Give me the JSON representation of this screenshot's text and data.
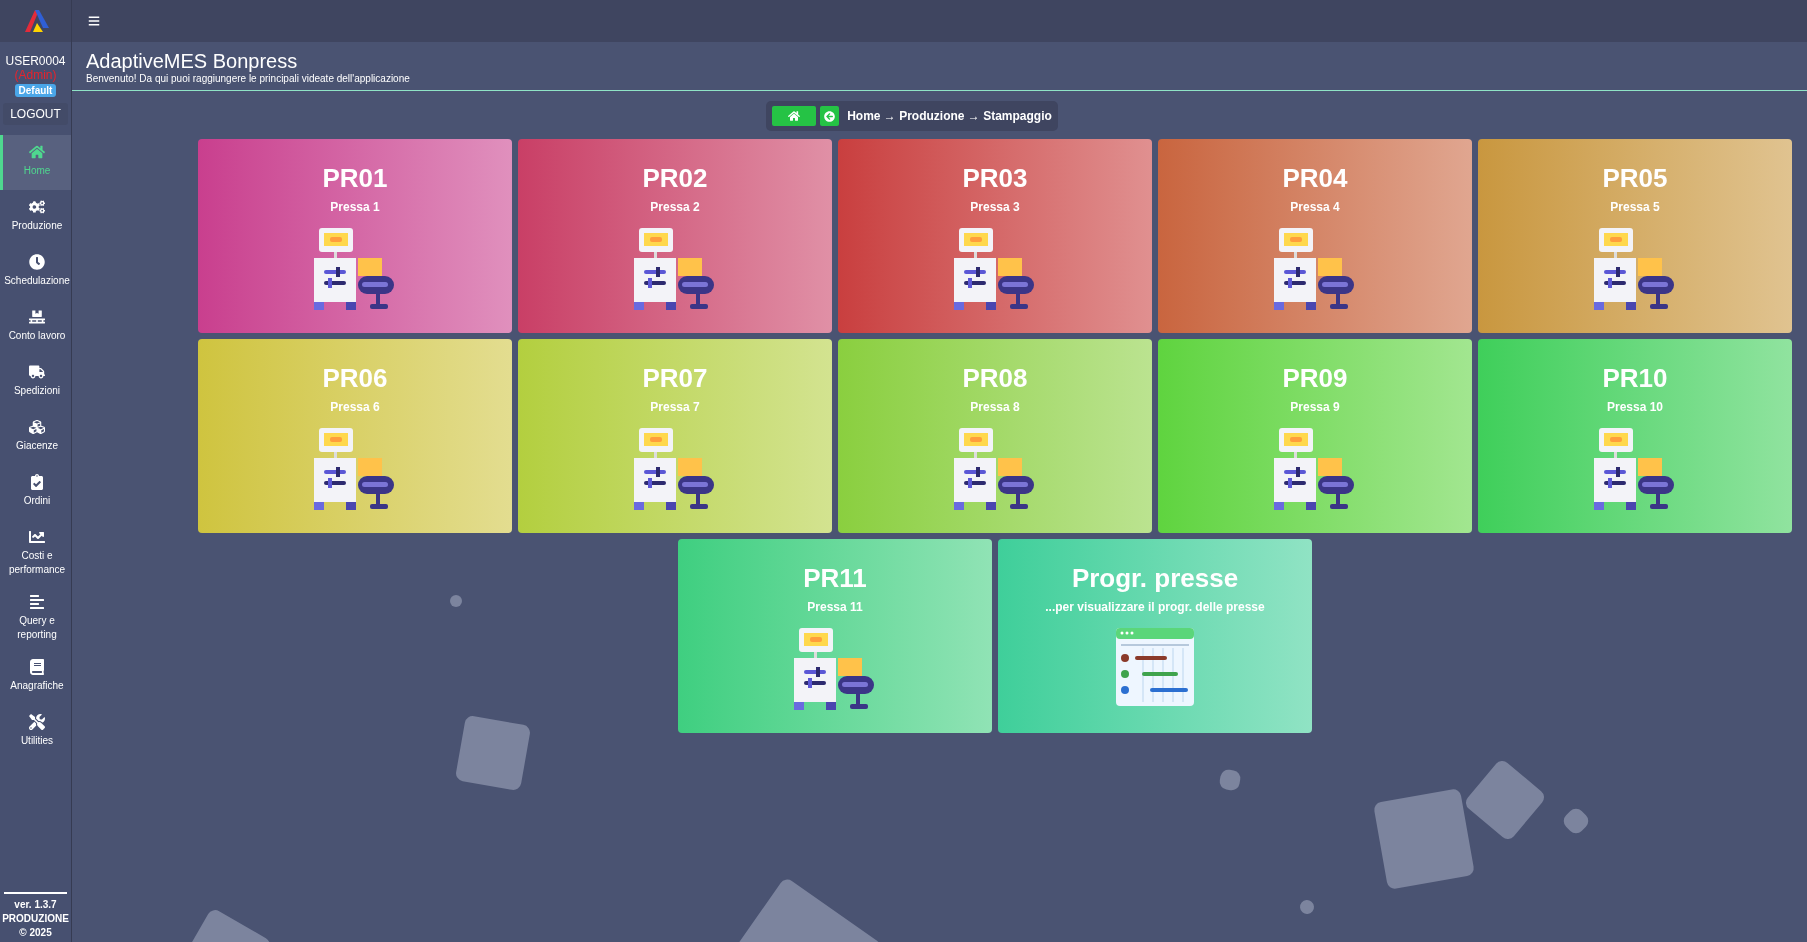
{
  "user": {
    "name": "USER0004",
    "role": "(Admin)",
    "profile": "Default",
    "logout": "LOGOUT"
  },
  "sidebar": {
    "items": [
      {
        "label": "Home",
        "selected": true
      },
      {
        "label": "Produzione",
        "selected": false
      },
      {
        "label": "Schedulazione",
        "selected": false
      },
      {
        "label": "Conto lavoro",
        "selected": false
      },
      {
        "label": "Spedizioni",
        "selected": false
      },
      {
        "label": "Giacenze",
        "selected": false
      },
      {
        "label": "Ordini",
        "selected": false
      },
      {
        "label": "Costi e performance",
        "selected": false
      },
      {
        "label": "Query e reporting",
        "selected": false
      },
      {
        "label": "Anagrafiche",
        "selected": false
      },
      {
        "label": "Utilities",
        "selected": false
      }
    ],
    "footer": [
      "ver. 1.3.7",
      "PRODUZIONE",
      "© 2025"
    ]
  },
  "header": {
    "title": "AdaptiveMES Bonpress",
    "subtitle": "Benvenuto! Da qui puoi raggiungere le principali videate dell'applicazione"
  },
  "breadcrumb": "Home → Produzione → Stampaggio",
  "cards": [
    {
      "title": "PR01",
      "subtitle": "Pressa 1",
      "kind": "press",
      "color": "#c93f8e"
    },
    {
      "title": "PR02",
      "subtitle": "Pressa 2",
      "kind": "press",
      "color": "#c93f66"
    },
    {
      "title": "PR03",
      "subtitle": "Pressa 3",
      "kind": "press",
      "color": "#c93f3f"
    },
    {
      "title": "PR04",
      "subtitle": "Pressa 4",
      "kind": "press",
      "color": "#c9653f"
    },
    {
      "title": "PR05",
      "subtitle": "Pressa 5",
      "kind": "press",
      "color": "#c9973f"
    },
    {
      "title": "PR06",
      "subtitle": "Pressa 6",
      "kind": "press",
      "color": "#cfc43f"
    },
    {
      "title": "PR07",
      "subtitle": "Pressa 7",
      "kind": "press",
      "color": "#b3cf3f"
    },
    {
      "title": "PR08",
      "subtitle": "Pressa 8",
      "kind": "press",
      "color": "#8acf3f"
    },
    {
      "title": "PR09",
      "subtitle": "Pressa 9",
      "kind": "press",
      "color": "#5fd43f"
    },
    {
      "title": "PR10",
      "subtitle": "Pressa 10",
      "kind": "press",
      "color": "#3fcf5a"
    },
    {
      "title": "PR11",
      "subtitle": "Pressa 11",
      "kind": "press",
      "color": "#3fcf80"
    },
    {
      "title": "Progr. presse",
      "subtitle": "...per visualizzare il progr. delle presse",
      "kind": "schedule",
      "color": "#3fcf9a"
    }
  ]
}
